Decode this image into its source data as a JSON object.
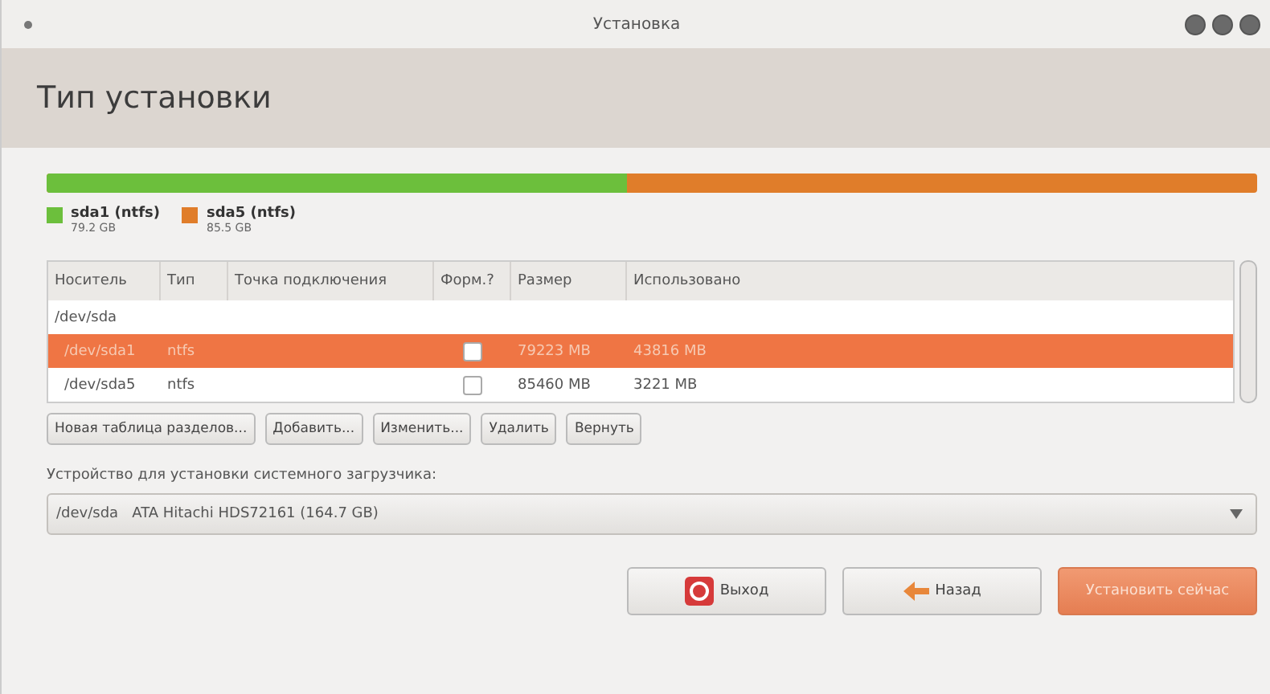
{
  "window": {
    "title": "Установка"
  },
  "header": {
    "title": "Тип установки"
  },
  "partitions": [
    {
      "name": "sda1 (ntfs)",
      "size": "79.2 GB",
      "color": "#6cbf3c",
      "level": 0.48
    },
    {
      "name": "sda5 (ntfs)",
      "size": "85.5 GB",
      "color": "#e07d2a"
    }
  ],
  "table": {
    "columns": [
      "Носитель",
      "Тип",
      "Точка подключения",
      "Форм.?",
      "Размер",
      "Использовано"
    ],
    "rows": [
      {
        "kind": "disk",
        "device": "/dev/sda",
        "selected": false
      },
      {
        "kind": "partition",
        "device": "/dev/sda1",
        "type": "ntfs",
        "format": false,
        "size": "79223 MB",
        "used": "43816 MB",
        "selected": true
      },
      {
        "kind": "partition",
        "device": "/dev/sda5",
        "type": "ntfs",
        "format": false,
        "size": "85460 MB",
        "used": "3221 MB",
        "selected": false
      }
    ]
  },
  "table_buttons": [
    "Новая таблица разделов...",
    "Добавить...",
    "Изменить...",
    "Удалить",
    "Вернуть"
  ],
  "bootloader": {
    "label": "Устройство для установки системного загрузчика:",
    "value": "/dev/sda   ATA Hitachi HDS72161 (164.7 GB)"
  },
  "footer_buttons": [
    {
      "kind": "quit",
      "label": "Выход"
    },
    {
      "kind": "back",
      "label": "Назад"
    },
    {
      "kind": "install",
      "label": "Установить сейчас"
    }
  ]
}
